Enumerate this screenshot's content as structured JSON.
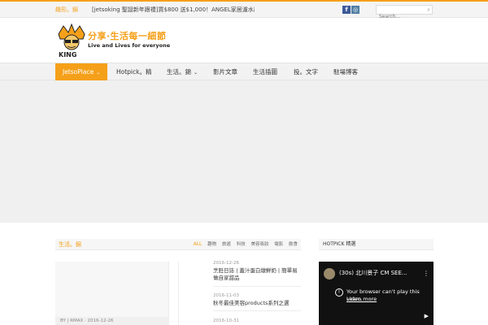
{
  "topbar": {
    "trending_label": "趣形。錦",
    "ticker_text": "[jetsoking 聖誕新年跟禮]買$800 送$1,000！ANGEL家居濾水器(禮...",
    "social": {
      "facebook": "f",
      "instagram": "◎"
    },
    "search_placeholder": "Search..."
  },
  "logo": {
    "tagline_cn": "分享‧生活每一細節",
    "tagline_en": "Live and Lives for everyone",
    "brand_text": "KING"
  },
  "nav": {
    "items": [
      {
        "label": "JetsoPlace",
        "has_caret": true
      },
      {
        "label": "Hotpick。精"
      },
      {
        "label": "生活。錦",
        "has_caret": true
      },
      {
        "label": "影片文章"
      },
      {
        "label": "生活插圖"
      },
      {
        "label": "投。文字"
      },
      {
        "label": "駐場博客"
      }
    ]
  },
  "block": {
    "title": "生活。錦",
    "filters": [
      "ALL",
      "趣物",
      "旅遊",
      "科技",
      "美容吸妝",
      "電影",
      "飲食"
    ]
  },
  "featured": {
    "meta": "BY | RMAX  ·  2016-12-26"
  },
  "posts": [
    {
      "date": "2016-12-26",
      "title": "烹飪日誌 | 蓋汁蛋白燉鮮奶 | 簡單易做自家甜品"
    },
    {
      "date": "2016-11-03",
      "title": "秋冬最佳美容products系列之選"
    },
    {
      "date": "2016-10-31",
      "title": ""
    }
  ],
  "sidebar": {
    "title": "HOTPICK 精選",
    "video": {
      "title": "(30s) 北川景子 CM SEE...",
      "notice": "Your browser can't play this video.",
      "learn_more": "Learn more"
    }
  },
  "colors": {
    "accent": "#f5a01a",
    "nav_bg": "#f2f2f2",
    "video_bg": "#111111"
  }
}
